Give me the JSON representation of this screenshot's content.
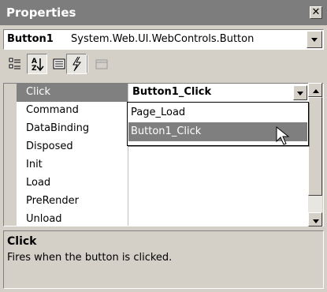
{
  "window": {
    "title": "Properties"
  },
  "object_selector": {
    "name": "Button1",
    "type": "System.Web.UI.WebControls.Button"
  },
  "toolbar": {
    "buttons": [
      {
        "icon": "categorized-icon"
      },
      {
        "icon": "alphabetical-icon",
        "pressed": true
      },
      {
        "icon": "properties-icon"
      },
      {
        "icon": "events-icon",
        "pressed": true
      },
      {
        "icon": "property-pages-icon"
      }
    ]
  },
  "grid": {
    "rows": [
      {
        "name": "Click",
        "value": "Button1_Click",
        "selected": true
      },
      {
        "name": "Command",
        "value": ""
      },
      {
        "name": "DataBinding",
        "value": ""
      },
      {
        "name": "Disposed",
        "value": ""
      },
      {
        "name": "Init",
        "value": ""
      },
      {
        "name": "Load",
        "value": ""
      },
      {
        "name": "PreRender",
        "value": ""
      },
      {
        "name": "Unload",
        "value": ""
      }
    ]
  },
  "dropdown": {
    "options": [
      "Page_Load",
      "Button1_Click"
    ],
    "highlighted": "Button1_Click"
  },
  "description": {
    "title": "Click",
    "text": "Fires when the button is clicked."
  },
  "colors": {
    "selection": "#808080",
    "titlebar": "#7d7d7d",
    "face": "#d4d0c8"
  }
}
